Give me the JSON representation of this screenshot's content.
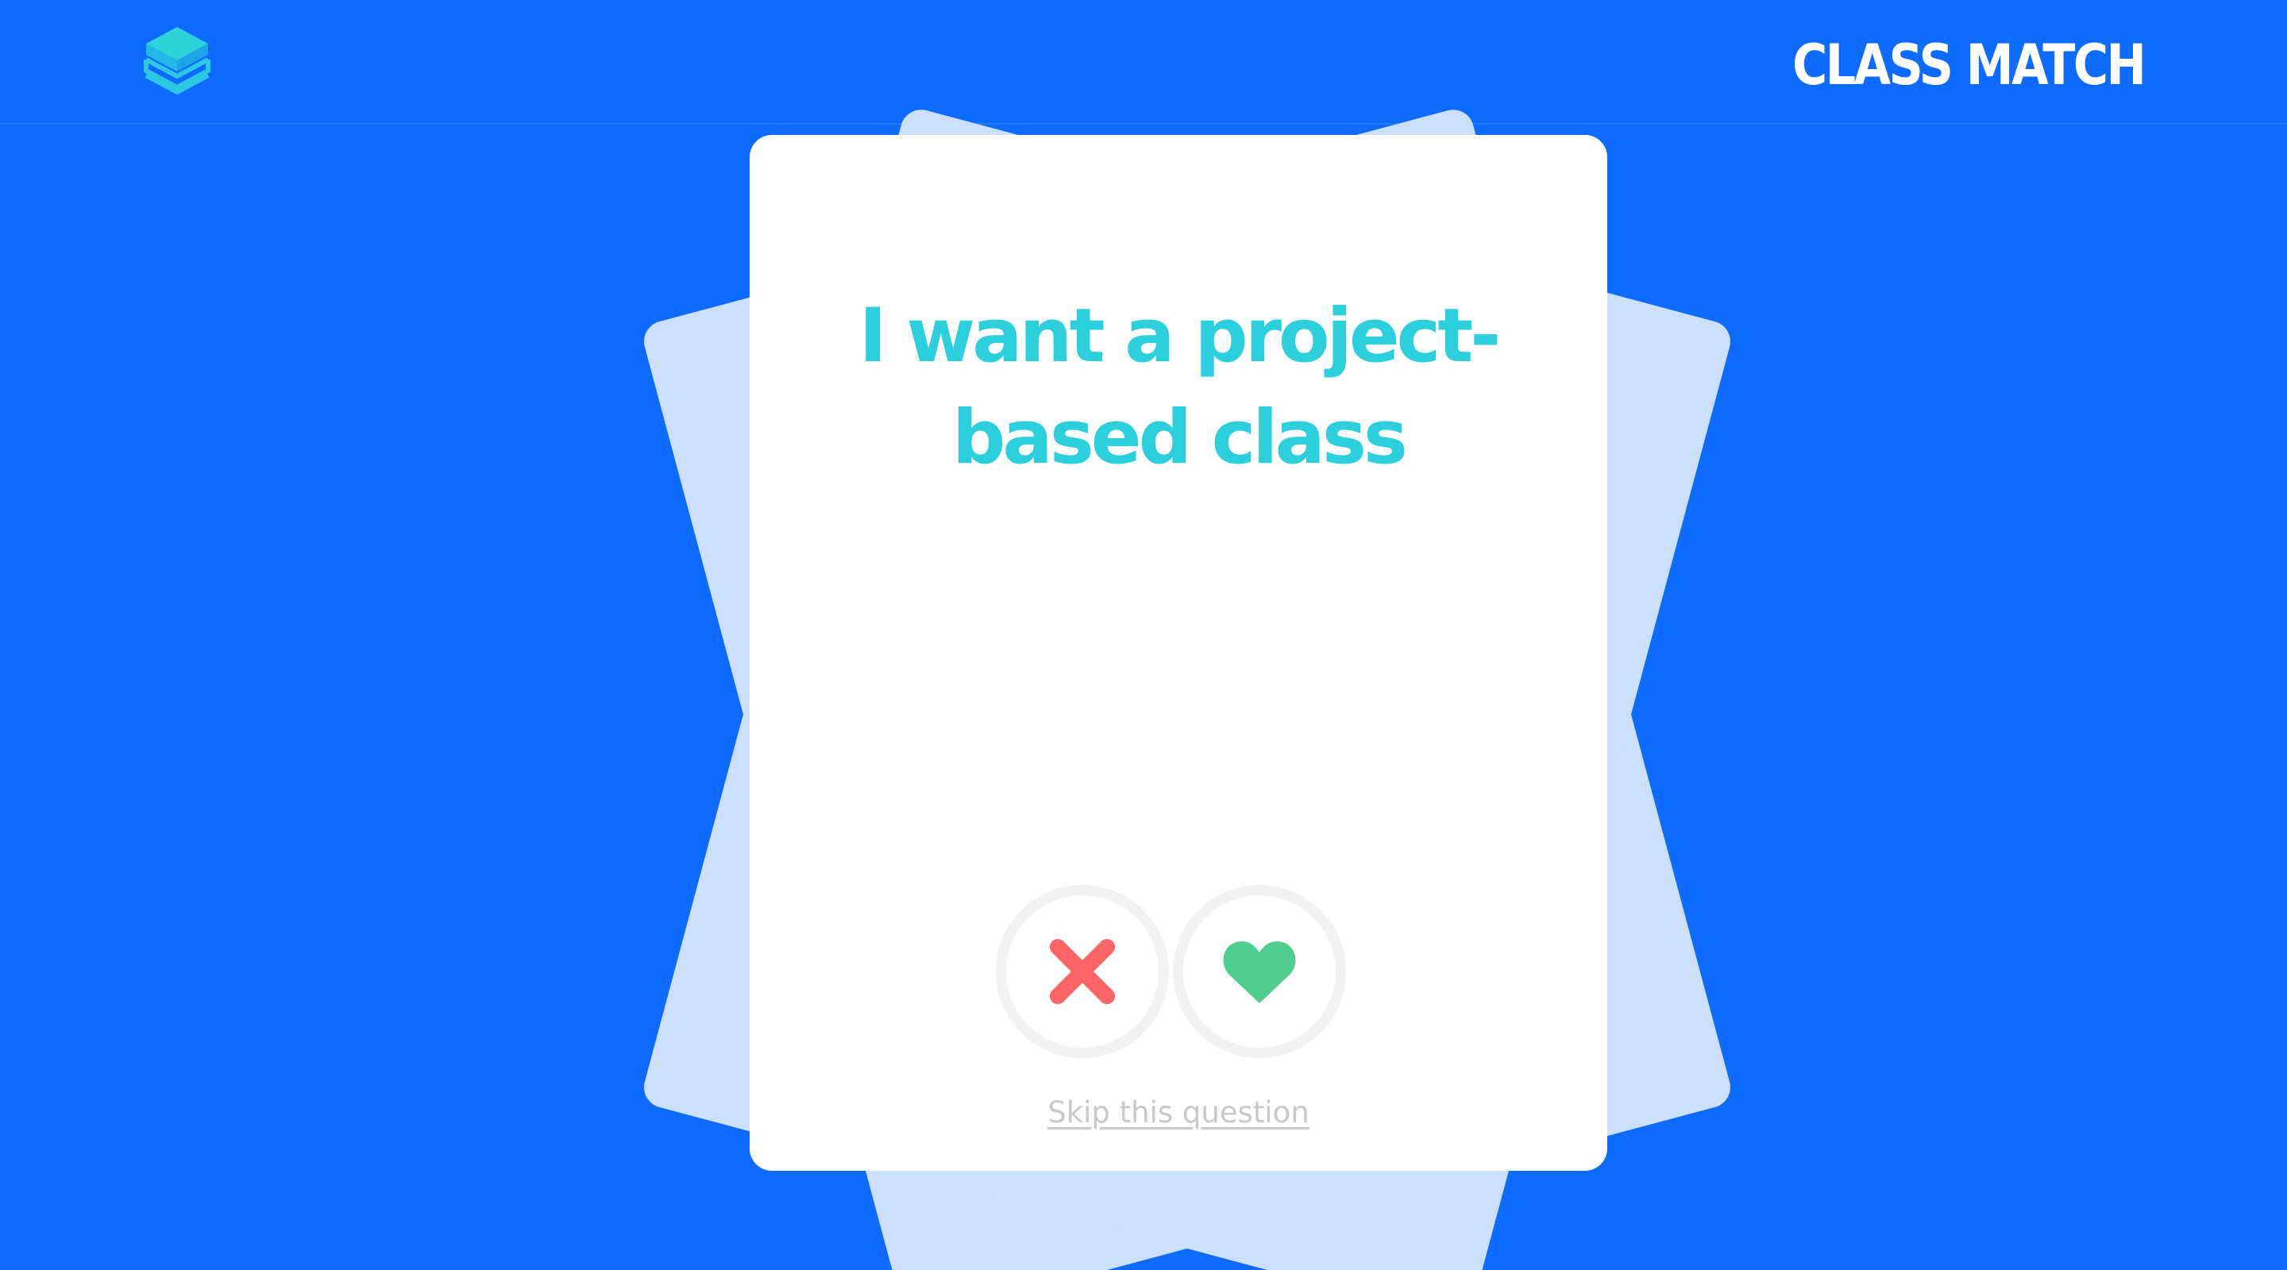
{
  "header": {
    "logo_icon": "stacked-boxes-logo-icon",
    "brand": "CLASS MATCH"
  },
  "card": {
    "question": "I want a project-based class",
    "dislike_icon": "x-icon",
    "like_icon": "heart-icon",
    "skip_label": "Skip this question"
  },
  "colors": {
    "background": "#0d6bff",
    "card_back": "#ccdfff",
    "question_text": "#2ccfdc",
    "dislike": "#ff6566",
    "like": "#4fce8f",
    "skip_text": "#c9c9c9"
  }
}
